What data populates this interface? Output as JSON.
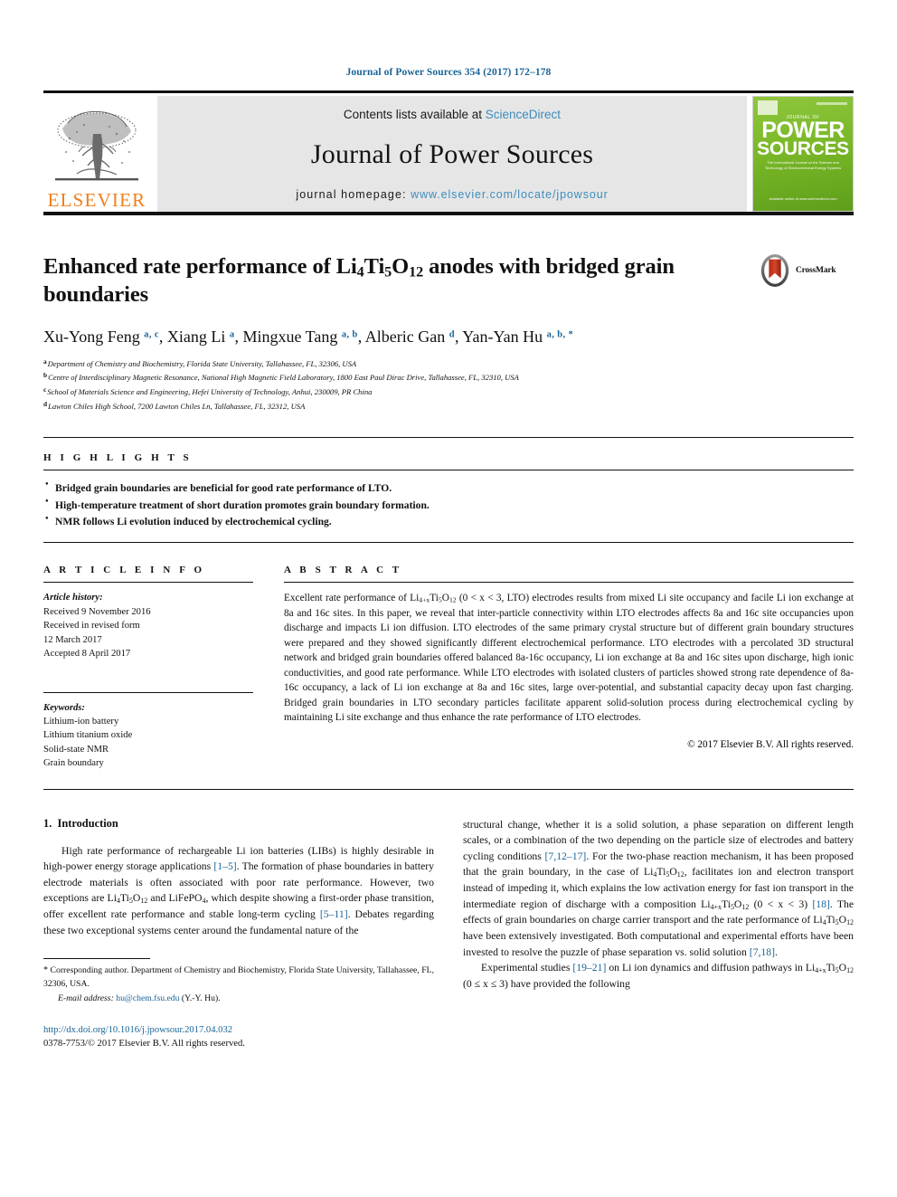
{
  "running_head": "Journal of Power Sources 354 (2017) 172–178",
  "masthead": {
    "publisher_logo_text": "ELSEVIER",
    "contents_prefix": "Contents lists available at",
    "contents_link": "ScienceDirect",
    "journal_name": "Journal of Power Sources",
    "homepage_prefix": "journal homepage:",
    "homepage_url": "www.elsevier.com/locate/jpowsour",
    "cover": {
      "kicker": "JOURNAL OF",
      "title_line1": "POWER",
      "title_line2": "SOURCES",
      "subtitle": "The International Journal on the Science and Technology of Electrochemical Energy Systems",
      "footer": "Available online at\nwww.sciencedirect.com"
    }
  },
  "article": {
    "title_part1": "Enhanced rate performance of Li",
    "title_sub1": "4",
    "title_part2": "Ti",
    "title_sub2": "5",
    "title_part3": "O",
    "title_sub3": "12",
    "title_part4": " anodes with bridged grain boundaries",
    "crossmark_label": "CrossMark",
    "authors": [
      {
        "name": "Xu-Yong Feng",
        "marks": "a, c"
      },
      {
        "name": "Xiang Li",
        "marks": "a"
      },
      {
        "name": "Mingxue Tang",
        "marks": "a, b"
      },
      {
        "name": "Alberic Gan",
        "marks": "d"
      },
      {
        "name": "Yan-Yan Hu",
        "marks": "a, b, *"
      }
    ],
    "affiliations": [
      {
        "mark": "a",
        "text": "Department of Chemistry and Biochemistry, Florida State University, Tallahassee, FL, 32306, USA"
      },
      {
        "mark": "b",
        "text": "Centre of Interdisciplinary Magnetic Resonance, National High Magnetic Field Laboratory, 1800 East Paul Dirac Drive, Tallahassee, FL, 32310, USA"
      },
      {
        "mark": "c",
        "text": "School of Materials Science and Engineering, Hefei University of Technology, Anhui, 230009, PR China"
      },
      {
        "mark": "d",
        "text": "Lawton Chiles High School, 7200 Lawton Chiles Ln, Tallahassee, FL, 32312, USA"
      }
    ]
  },
  "highlights": {
    "heading": "H I G H L I G H T S",
    "items": [
      "Bridged grain boundaries are beneficial for good rate performance of LTO.",
      "High-temperature treatment of short duration promotes grain boundary formation.",
      "NMR follows Li evolution induced by electrochemical cycling."
    ]
  },
  "article_info": {
    "heading": "A R T I C L E   I N F O",
    "history_label": "Article history:",
    "history": [
      "Received 9 November 2016",
      "Received in revised form",
      "12 March 2017",
      "Accepted 8 April 2017"
    ],
    "keywords_label": "Keywords:",
    "keywords": [
      "Lithium-ion battery",
      "Lithium titanium oxide",
      "Solid-state NMR",
      "Grain boundary"
    ]
  },
  "abstract": {
    "heading": "A B S T R A C T",
    "text_p1": "Excellent rate performance of Li",
    "text_sub1": "4+x",
    "text_p2": "Ti",
    "text_sub2": "5",
    "text_p3": "O",
    "text_sub3": "12",
    "text_p4": " (0 < x < 3, LTO) electrodes results from mixed Li site occupancy and facile Li ion exchange at 8a and 16c sites. In this paper, we reveal that inter-particle connectivity within LTO electrodes affects 8a and 16c site occupancies upon discharge and impacts Li ion diffusion. LTO electrodes of the same primary crystal structure but of different grain boundary structures were prepared and they showed significantly different electrochemical performance. LTO electrodes with a percolated 3D structural network and bridged grain boundaries offered balanced 8a-16c occupancy, Li ion exchange at 8a and 16c sites upon discharge, high ionic conductivities, and good rate performance. While LTO electrodes with isolated clusters of particles showed strong rate dependence of 8a-16c occupancy, a lack of Li ion exchange at 8a and 16c sites, large over-potential, and substantial capacity decay upon fast charging. Bridged grain boundaries in LTO secondary particles facilitate apparent solid-solution process during electrochemical cycling by maintaining Li site exchange and thus enhance the rate performance of LTO electrodes.",
    "copyright": "© 2017 Elsevier B.V. All rights reserved."
  },
  "introduction": {
    "section_number": "1.",
    "section_title": "Introduction",
    "left_p1_a": "High rate performance of rechargeable Li ion batteries (LIBs) is highly desirable in high-power energy storage applications ",
    "left_p1_ref1": "[1–5]",
    "left_p1_b": ". The formation of phase boundaries in battery electrode materials is often associated with poor rate performance. However, two exceptions are Li",
    "left_p1_sub1": "4",
    "left_p1_c": "Ti",
    "left_p1_sub2": "5",
    "left_p1_d": "O",
    "left_p1_sub3": "12",
    "left_p1_e": " and LiFePO",
    "left_p1_sub4": "4",
    "left_p1_f": ", which despite showing a first-order phase transition, offer excellent rate performance and stable long-term cycling ",
    "left_p1_ref2": "[5–11]",
    "left_p1_g": ". Debates regarding these two exceptional systems center around the fundamental nature of the",
    "right_p1_a": "structural change, whether it is a solid solution, a phase separation on different length scales, or a combination of the two depending on the particle size of electrodes and battery cycling conditions ",
    "right_p1_ref1": "[7,12–17]",
    "right_p1_b": ". For the two-phase reaction mechanism, it has been proposed that the grain boundary, in the case of Li",
    "right_p1_sub1": "4",
    "right_p1_c": "Ti",
    "right_p1_sub2": "5",
    "right_p1_d": "O",
    "right_p1_sub3": "12",
    "right_p1_e": ", facilitates ion and electron transport instead of impeding it, which explains the low activation energy for fast ion transport in the intermediate region of discharge with a composition Li",
    "right_p1_sub4": "4+x",
    "right_p1_f": "Ti",
    "right_p1_sub5": "5",
    "right_p1_g": "O",
    "right_p1_sub6": "12",
    "right_p1_h": " (0 < x < 3) ",
    "right_p1_ref2": "[18]",
    "right_p1_i": ". The effects of grain boundaries on charge carrier transport and the rate performance of Li",
    "right_p1_sub7": "4",
    "right_p1_j": "Ti",
    "right_p1_sub8": "5",
    "right_p1_k": "O",
    "right_p1_sub9": "12",
    "right_p1_l": " have been extensively investigated. Both computational and experimental efforts have been invested to resolve the puzzle of phase separation vs. solid solution ",
    "right_p1_ref3": "[7,18]",
    "right_p1_m": ".",
    "right_p2_a": "Experimental studies ",
    "right_p2_ref1": "[19–21]",
    "right_p2_b": " on Li ion dynamics and diffusion pathways in Li",
    "right_p2_sub1": "4+x",
    "right_p2_c": "Ti",
    "right_p2_sub2": "5",
    "right_p2_d": "O",
    "right_p2_sub3": "12",
    "right_p2_e": " (0 ≤ x ≤ 3) have provided the following"
  },
  "footnote": {
    "star": "*",
    "corresponding": " Corresponding author. Department of Chemistry and Biochemistry, Florida State University, Tallahassee, FL, 32306, USA.",
    "email_label": "E-mail address:",
    "email": "hu@chem.fsu.edu",
    "email_suffix": " (Y.-Y. Hu).",
    "doi": "http://dx.doi.org/10.1016/j.jpowsour.2017.04.032",
    "issn": "0378-7753/© 2017 Elsevier B.V. All rights reserved."
  },
  "colors": {
    "link": "#1a6496",
    "elsevier_orange": "#f07f1a",
    "masthead_bg": "#e6e6e6",
    "cover_green": "#7ab828"
  }
}
